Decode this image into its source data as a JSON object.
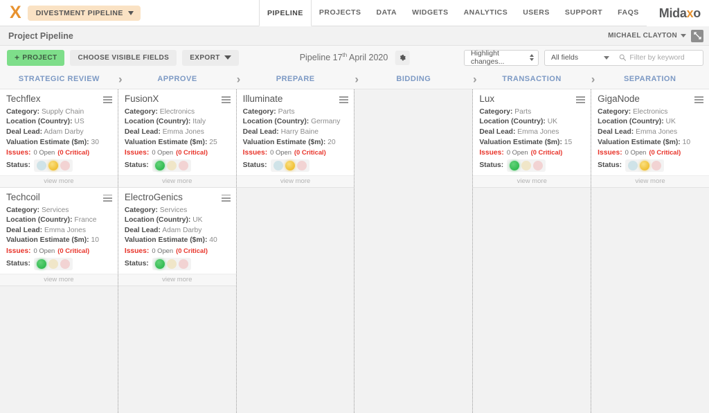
{
  "topnav": {
    "logo_mark": "X",
    "pipeline_selector": "DIVESTMENT PIPELINE",
    "items": [
      {
        "label": "PIPELINE",
        "active": true
      },
      {
        "label": "PROJECTS",
        "active": false
      },
      {
        "label": "DATA",
        "active": false
      },
      {
        "label": "WIDGETS",
        "active": false
      },
      {
        "label": "ANALYTICS",
        "active": false
      },
      {
        "label": "USERS",
        "active": false
      },
      {
        "label": "SUPPORT",
        "active": false
      },
      {
        "label": "FAQS",
        "active": false
      }
    ],
    "brand_prefix": "Mida",
    "brand_accent": "x",
    "brand_suffix": "o"
  },
  "titlebar": {
    "page_title": "Project Pipeline",
    "user_name": "MICHAEL CLAYTON"
  },
  "toolbar": {
    "add_project_label": "PROJECT",
    "choose_fields_label": "CHOOSE VISIBLE FIELDS",
    "export_label": "EXPORT",
    "pipeline_date_prefix": "Pipeline 17",
    "pipeline_date_ordinal": "th",
    "pipeline_date_suffix": "April 2020",
    "highlight_select": "Highlight changes...",
    "fields_select": "All fields",
    "filter_placeholder": "Filter by keyword",
    "filter_value": ""
  },
  "stages": [
    {
      "label": "STRATEGIC REVIEW"
    },
    {
      "label": "APPROVE"
    },
    {
      "label": "PREPARE"
    },
    {
      "label": "BIDDING"
    },
    {
      "label": "TRANSACTION"
    },
    {
      "label": "SEPARATION"
    }
  ],
  "card_labels": {
    "category": "Category:",
    "location": "Location (Country):",
    "deal_lead": "Deal Lead:",
    "valuation": "Valuation Estimate ($m):",
    "issues": "Issues:",
    "status": "Status:",
    "view_more": "view more"
  },
  "columns": [
    {
      "stage": "STRATEGIC REVIEW",
      "cards": [
        {
          "title": "Techflex",
          "category": "Supply Chain",
          "location": "US",
          "deal_lead": "Adam Darby",
          "valuation": "30",
          "issues_open": "0 Open",
          "issues_critical": "(0 Critical)",
          "status": "yellow"
        },
        {
          "title": "Techcoil",
          "category": "Services",
          "location": "France",
          "deal_lead": "Emma Jones",
          "valuation": "10",
          "issues_open": "0 Open",
          "issues_critical": "(0 Critical)",
          "status": "green"
        }
      ]
    },
    {
      "stage": "APPROVE",
      "cards": [
        {
          "title": "FusionX",
          "category": "Electronics",
          "location": "Italy",
          "deal_lead": "Emma Jones",
          "valuation": "25",
          "issues_open": "0 Open",
          "issues_critical": "(0 Critical)",
          "status": "green"
        },
        {
          "title": "ElectroGenics",
          "category": "Services",
          "location": "UK",
          "deal_lead": "Adam Darby",
          "valuation": "40",
          "issues_open": "0 Open",
          "issues_critical": "(0 Critical)",
          "status": "green"
        }
      ]
    },
    {
      "stage": "PREPARE",
      "cards": [
        {
          "title": "Illuminate",
          "category": "Parts",
          "location": "Germany",
          "deal_lead": "Harry Baine",
          "valuation": "20",
          "issues_open": "0 Open",
          "issues_critical": "(0 Critical)",
          "status": "yellow"
        }
      ]
    },
    {
      "stage": "BIDDING",
      "cards": []
    },
    {
      "stage": "TRANSACTION",
      "cards": [
        {
          "title": "Lux",
          "category": "Parts",
          "location": "UK",
          "deal_lead": "Emma Jones",
          "valuation": "15",
          "issues_open": "0 Open",
          "issues_critical": "(0 Critical)",
          "status": "green"
        }
      ]
    },
    {
      "stage": "SEPARATION",
      "cards": [
        {
          "title": "GigaNode",
          "category": "Electronics",
          "location": "UK",
          "deal_lead": "Emma Jones",
          "valuation": "10",
          "issues_open": "0 Open",
          "issues_critical": "(0 Critical)",
          "status": "yellow"
        }
      ]
    }
  ],
  "colors": {
    "accent_orange": "#e8922f",
    "stage_blue": "#7c99c4",
    "issue_red": "#e8342a",
    "add_green": "#7ede8a"
  }
}
